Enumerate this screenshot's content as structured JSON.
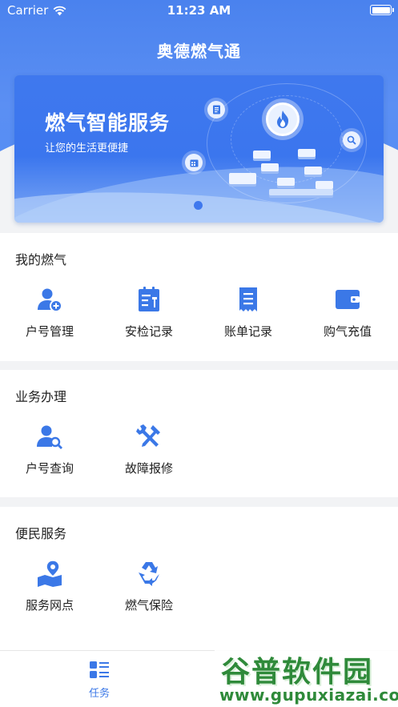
{
  "status_bar": {
    "carrier": "Carrier",
    "time": "11:23 AM",
    "wifi_icon": "wifi-icon",
    "battery_icon": "battery-icon"
  },
  "nav": {
    "title": "奥德燃气通"
  },
  "banner": {
    "title": "燃气智能服务",
    "subtitle": "让您的生活更便捷",
    "page_count": 1,
    "active_page": 1
  },
  "sections": {
    "my_gas": {
      "title": "我的燃气",
      "items": [
        {
          "label": "户号管理",
          "icon": "user-add-icon"
        },
        {
          "label": "安检记录",
          "icon": "clipboard-tool-icon"
        },
        {
          "label": "账单记录",
          "icon": "receipt-icon"
        },
        {
          "label": "购气充值",
          "icon": "wallet-icon"
        }
      ]
    },
    "business": {
      "title": "业务办理",
      "items": [
        {
          "label": "户号查询",
          "icon": "user-search-icon"
        },
        {
          "label": "故障报修",
          "icon": "repair-tools-icon"
        }
      ]
    },
    "convenience": {
      "title": "便民服务",
      "items": [
        {
          "label": "服务网点",
          "icon": "map-pin-icon"
        },
        {
          "label": "燃气保险",
          "icon": "recycle-icon"
        }
      ]
    }
  },
  "tabbar": {
    "tabs": [
      {
        "label": "任务",
        "icon": "task-list-icon",
        "active": true
      }
    ]
  },
  "watermark": {
    "title": "谷普软件园",
    "url": "www.gupuxiazai.com"
  },
  "colors": {
    "brand": "#3b78e7",
    "background": "#f2f3f5",
    "watermark": "#2f8a3a"
  }
}
